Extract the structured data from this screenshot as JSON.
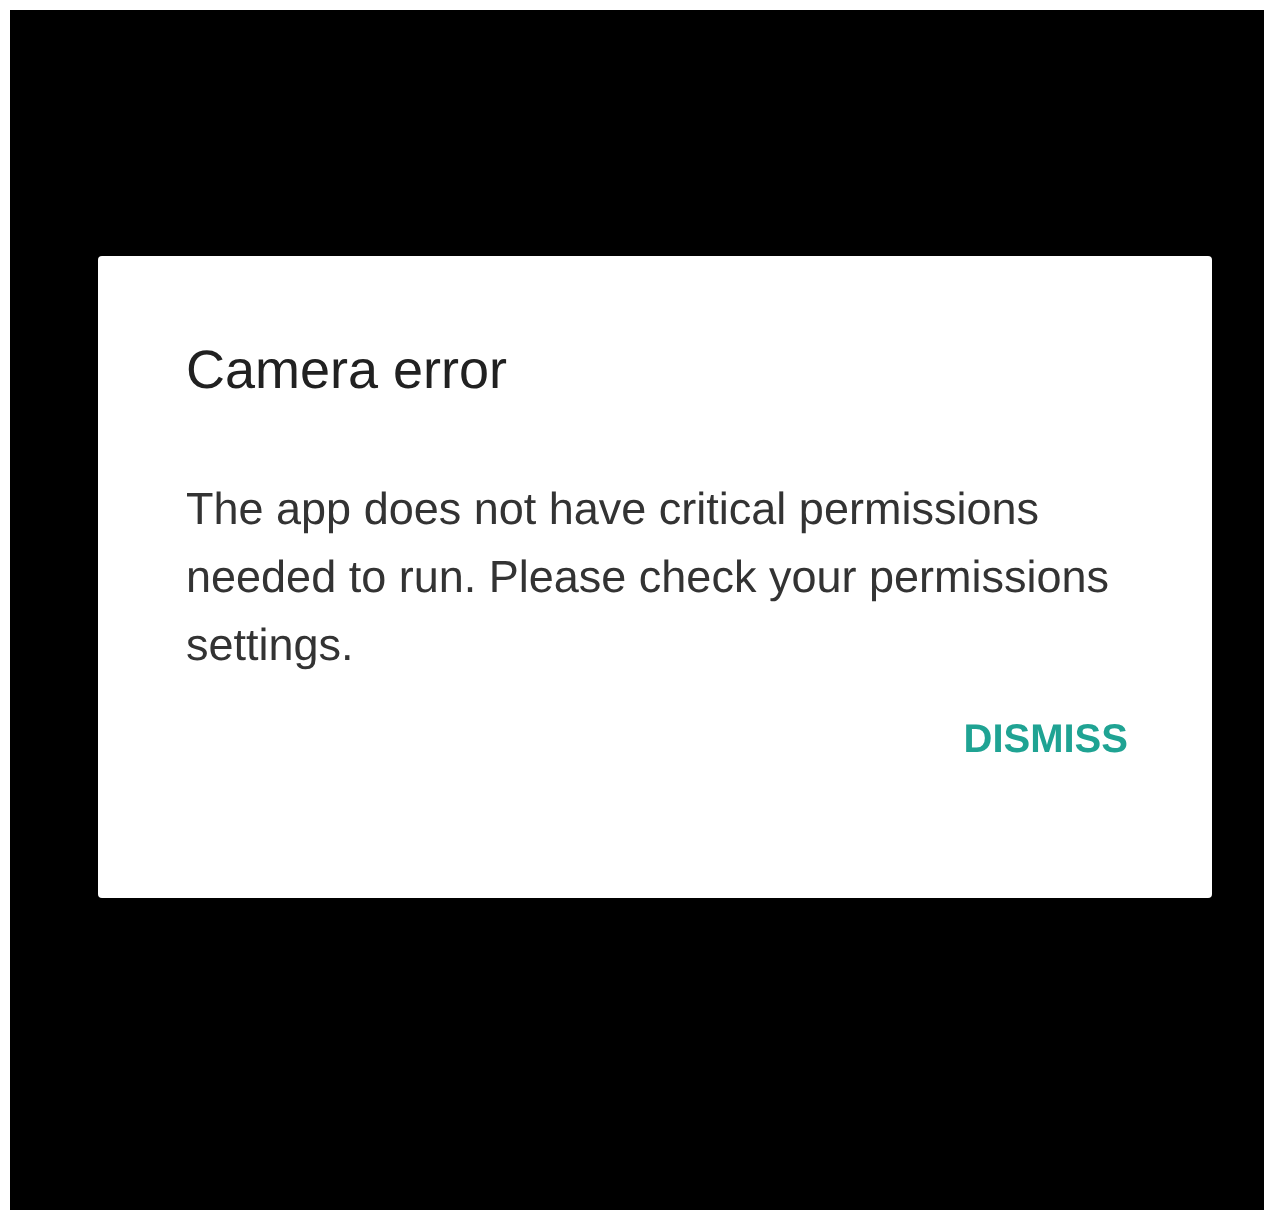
{
  "dialog": {
    "title": "Camera error",
    "message": "The app does not have critical permissions needed to run. Please check your permissions settings.",
    "buttons": [
      "DISMISS"
    ]
  }
}
